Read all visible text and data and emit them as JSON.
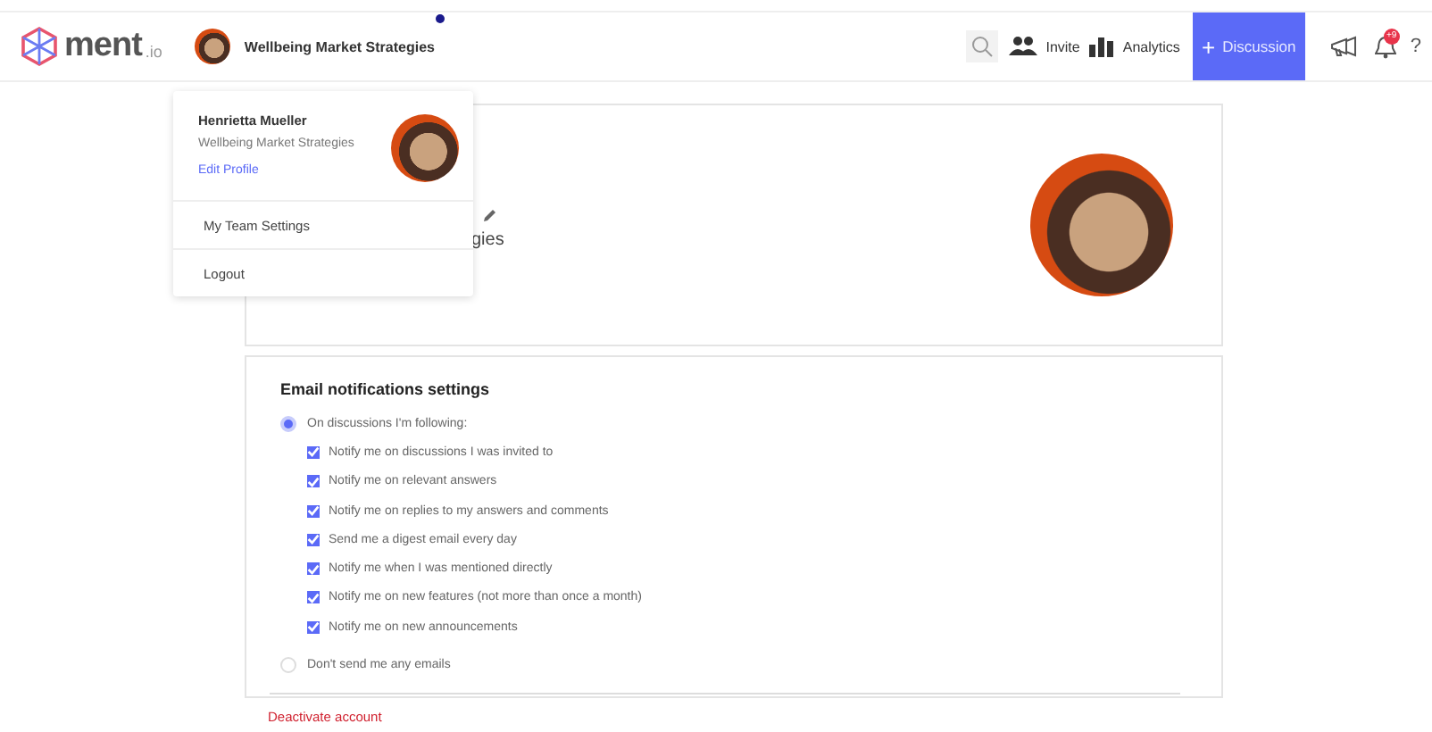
{
  "header": {
    "logo": {
      "word": "ment",
      "suffix": ".io"
    },
    "team": {
      "name": "Wellbeing Market Strategies",
      "unread": true
    },
    "actions": [
      {
        "kind": "search"
      },
      {
        "kind": "invite",
        "label": "Invite"
      },
      {
        "kind": "analytics",
        "label": "Analytics"
      },
      {
        "kind": "primary",
        "icon": "+",
        "label": "Discussion"
      },
      {
        "kind": "megaphone"
      },
      {
        "kind": "bell",
        "badge": "+9"
      },
      {
        "kind": "help",
        "label": "?"
      }
    ]
  },
  "user_menu": {
    "name": "Henrietta Mueller",
    "team": "Wellbeing Market Strategies",
    "edit_link": "Edit Profile",
    "items": [
      "My Team Settings",
      "Logout"
    ]
  },
  "profile_card": {
    "visible_text": "gies"
  },
  "email_settings": {
    "title": "Email notifications settings",
    "options": [
      {
        "label": "On discussions I'm following:",
        "selected": true,
        "children": [
          {
            "label": "Notify me on discussions I was invited to",
            "checked": true
          },
          {
            "label": "Notify me on relevant answers",
            "checked": true
          },
          {
            "label": "Notify me on replies to my answers and comments",
            "checked": true
          },
          {
            "label": "Send me a digest email every day",
            "checked": true
          },
          {
            "label": "Notify me when I was mentioned directly",
            "checked": true
          },
          {
            "label": "Notify me on new features (not more than once a month)",
            "checked": true
          },
          {
            "label": "Notify me on new announcements",
            "checked": true
          }
        ]
      },
      {
        "label": "Don't send me any emails",
        "selected": false
      }
    ]
  },
  "deactivate_link": "Deactivate account"
}
